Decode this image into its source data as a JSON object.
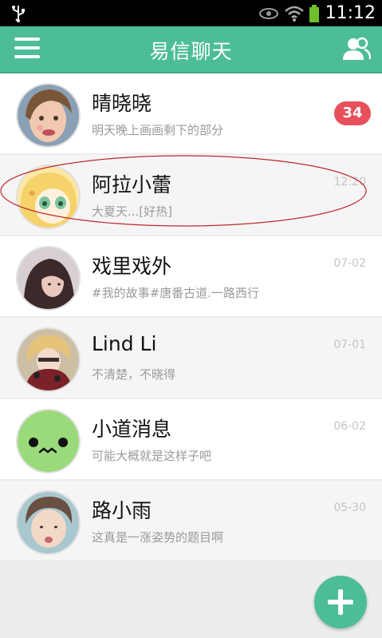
{
  "status_bar": {
    "time": "11:12"
  },
  "header": {
    "title": "易信聊天"
  },
  "conversations": [
    {
      "name": "晴晓晓",
      "preview": "明天晚上画画剩下的部分",
      "badge": "34",
      "time": ""
    },
    {
      "name": "阿拉小蕾",
      "preview": "大夏天...[好热]",
      "time": "12:20"
    },
    {
      "name": "戏里戏外",
      "preview": "#我的故事#唐番古道.一路西行",
      "time": "07-02"
    },
    {
      "name": "Lind Li",
      "preview": "不清楚，不晓得",
      "time": "07-01"
    },
    {
      "name": "小道消息",
      "preview": "可能大概就是这样子吧",
      "time": "06-02"
    },
    {
      "name": "路小雨",
      "preview": "这真是一涨姿势的题目啊",
      "time": "05-30"
    }
  ],
  "colors": {
    "accent": "#4dbd99",
    "badge": "#e8505b",
    "annotation": "#c0282d"
  },
  "icons": {
    "menu": "hamburger-icon",
    "contacts": "contacts-icon",
    "add": "plus-icon"
  }
}
